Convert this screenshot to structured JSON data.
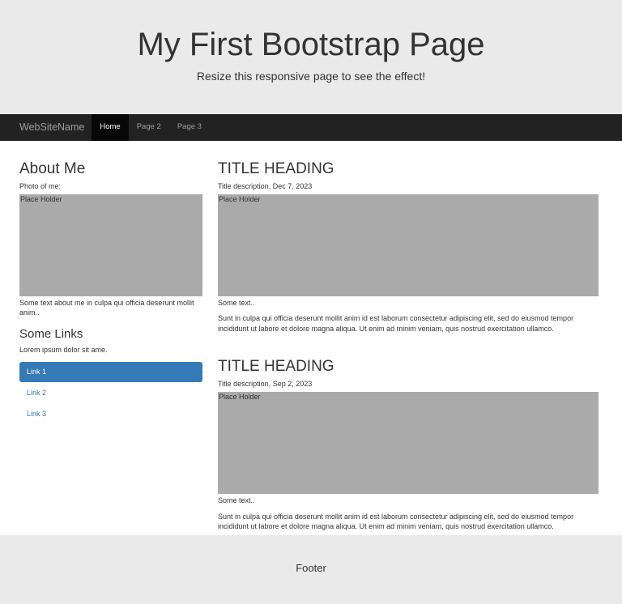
{
  "header": {
    "title": "My First Bootstrap Page",
    "subtitle": "Resize this responsive page to see the effect!"
  },
  "navbar": {
    "brand": "WebSiteName",
    "items": [
      {
        "label": "Home",
        "active": true
      },
      {
        "label": "Page 2",
        "active": false
      },
      {
        "label": "Page 3",
        "active": false
      }
    ]
  },
  "sidebar": {
    "about_heading": "About Me",
    "photo_label": "Photo of me:",
    "placeholder": "Place Holder",
    "about_text": "Some text about me in culpa qui officia deserunt mollit anim..",
    "links_heading": "Some Links",
    "links_text": "Lorem ipsum dolor sit ame.",
    "links": [
      {
        "label": "Link 1",
        "active": true
      },
      {
        "label": "Link 2",
        "active": false
      },
      {
        "label": "Link 3",
        "active": false
      }
    ]
  },
  "posts": [
    {
      "title": "TITLE HEADING",
      "description": "Title description, Dec 7, 2023",
      "placeholder": "Place Holder",
      "short_text": "Some text..",
      "body": "Sunt in culpa qui officia deserunt mollit anim id est laborum consectetur adipiscing elit, sed do eiusmod tempor incididunt ut labore et dolore magna aliqua. Ut enim ad minim veniam, quis nostrud exercitation ullamco."
    },
    {
      "title": "TITLE HEADING",
      "description": "Title description, Sep 2, 2023",
      "placeholder": "Place Holder",
      "short_text": "Some text..",
      "body": "Sunt in culpa qui officia deserunt mollit anim id est laborum consectetur adipiscing elit, sed do eiusmod tempor incididunt ut labore et dolore magna aliqua. Ut enim ad minim veniam, quis nostrud exercitation ullamco."
    }
  ],
  "footer": {
    "text": "Footer"
  },
  "colors": {
    "jumbotron_bg": "#eaeaea",
    "navbar_bg": "#222222",
    "nav_active_bg": "#080808",
    "placeholder_bg": "#aaaaaa",
    "link_accent": "#337ab7"
  }
}
